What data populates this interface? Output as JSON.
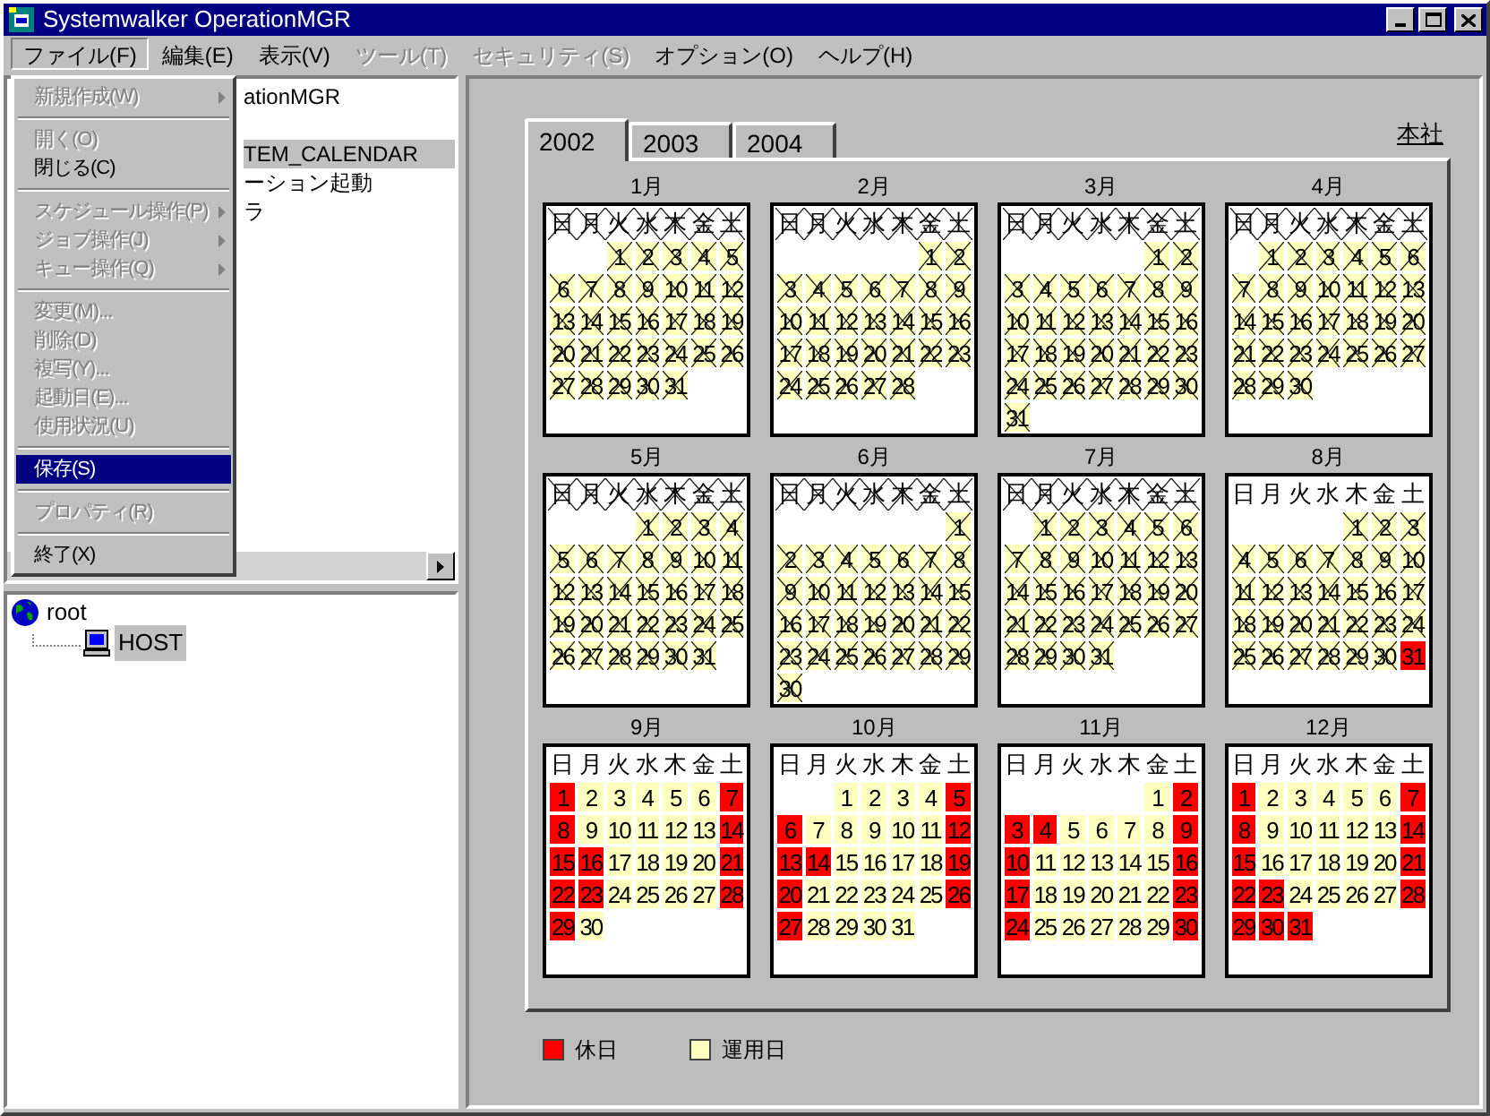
{
  "window": {
    "title": "Systemwalker OperationMGR"
  },
  "menu_bar": [
    {
      "label": "ファイル(F)",
      "selected": true,
      "disabled": false
    },
    {
      "label": "編集(E)",
      "selected": false,
      "disabled": false
    },
    {
      "label": "表示(V)",
      "selected": false,
      "disabled": false
    },
    {
      "label": "ツール(T)",
      "selected": false,
      "disabled": true
    },
    {
      "label": "セキュリティ(S)",
      "selected": false,
      "disabled": true
    },
    {
      "label": "オプション(O)",
      "selected": false,
      "disabled": false
    },
    {
      "label": "ヘルプ(H)",
      "selected": false,
      "disabled": false
    }
  ],
  "file_menu": [
    {
      "kind": "item",
      "label": "新規作成(W)",
      "disabled": true,
      "submenu": true,
      "selected": false
    },
    {
      "kind": "separator"
    },
    {
      "kind": "item",
      "label": "開く(O)",
      "disabled": true,
      "submenu": false,
      "selected": false
    },
    {
      "kind": "item",
      "label": "閉じる(C)",
      "disabled": false,
      "submenu": false,
      "selected": false
    },
    {
      "kind": "separator"
    },
    {
      "kind": "item",
      "label": "スケジュール操作(P)",
      "disabled": true,
      "submenu": true,
      "selected": false
    },
    {
      "kind": "item",
      "label": "ジョブ操作(J)",
      "disabled": true,
      "submenu": true,
      "selected": false
    },
    {
      "kind": "item",
      "label": "キュー操作(Q)",
      "disabled": true,
      "submenu": true,
      "selected": false
    },
    {
      "kind": "separator"
    },
    {
      "kind": "item",
      "label": "変更(M)...",
      "disabled": true,
      "submenu": false,
      "selected": false
    },
    {
      "kind": "item",
      "label": "削除(D)",
      "disabled": true,
      "submenu": false,
      "selected": false
    },
    {
      "kind": "item",
      "label": "複写(Y)...",
      "disabled": true,
      "submenu": false,
      "selected": false
    },
    {
      "kind": "item",
      "label": "起動日(E)...",
      "disabled": true,
      "submenu": false,
      "selected": false
    },
    {
      "kind": "item",
      "label": "使用状況(U)",
      "disabled": true,
      "submenu": false,
      "selected": false
    },
    {
      "kind": "separator"
    },
    {
      "kind": "item",
      "label": "保存(S)",
      "disabled": false,
      "submenu": false,
      "selected": true
    },
    {
      "kind": "separator"
    },
    {
      "kind": "item",
      "label": "プロパティ(R)",
      "disabled": true,
      "submenu": false,
      "selected": false
    },
    {
      "kind": "separator"
    },
    {
      "kind": "item",
      "label": "終了(X)",
      "disabled": false,
      "submenu": false,
      "selected": false
    }
  ],
  "tree_top": [
    {
      "label": "ationMGR",
      "selected": false
    },
    {
      "label": "TEM_CALENDAR",
      "selected": true
    },
    {
      "label": "ーション起動",
      "selected": false
    },
    {
      "label": "ラ",
      "selected": false
    }
  ],
  "tree_bottom": {
    "label": "root",
    "selected": false,
    "children": [
      {
        "label": "HOST",
        "selected": true
      }
    ]
  },
  "tabs": [
    {
      "label": "2002",
      "selected": true
    },
    {
      "label": "2003",
      "selected": false
    },
    {
      "label": "2004",
      "selected": false
    }
  ],
  "location": "本社",
  "months": [
    {
      "title": "1月",
      "weekdays": [
        "日",
        "月",
        "火",
        "水",
        "木",
        "金",
        "土"
      ],
      "header_crossed": true,
      "days": [
        {
          "kind": "blank"
        },
        {
          "kind": "blank"
        },
        {
          "label": "1",
          "kind": "past"
        },
        {
          "label": "2",
          "kind": "past"
        },
        {
          "label": "3",
          "kind": "past"
        },
        {
          "label": "4",
          "kind": "past"
        },
        {
          "label": "5",
          "kind": "past"
        },
        {
          "label": "6",
          "kind": "past"
        },
        {
          "label": "7",
          "kind": "past"
        },
        {
          "label": "8",
          "kind": "past"
        },
        {
          "label": "9",
          "kind": "past"
        },
        {
          "label": "10",
          "kind": "past"
        },
        {
          "label": "11",
          "kind": "past"
        },
        {
          "label": "12",
          "kind": "past"
        },
        {
          "label": "13",
          "kind": "past"
        },
        {
          "label": "14",
          "kind": "past"
        },
        {
          "label": "15",
          "kind": "past"
        },
        {
          "label": "16",
          "kind": "past"
        },
        {
          "label": "17",
          "kind": "past"
        },
        {
          "label": "18",
          "kind": "past"
        },
        {
          "label": "19",
          "kind": "past"
        },
        {
          "label": "20",
          "kind": "past"
        },
        {
          "label": "21",
          "kind": "past"
        },
        {
          "label": "22",
          "kind": "past"
        },
        {
          "label": "23",
          "kind": "past"
        },
        {
          "label": "24",
          "kind": "past"
        },
        {
          "label": "25",
          "kind": "past"
        },
        {
          "label": "26",
          "kind": "past"
        },
        {
          "label": "27",
          "kind": "past"
        },
        {
          "label": "28",
          "kind": "past"
        },
        {
          "label": "29",
          "kind": "past"
        },
        {
          "label": "30",
          "kind": "past"
        },
        {
          "label": "31",
          "kind": "past"
        }
      ]
    },
    {
      "title": "2月",
      "weekdays": [
        "日",
        "月",
        "火",
        "水",
        "木",
        "金",
        "土"
      ],
      "header_crossed": true,
      "days": [
        {
          "kind": "blank"
        },
        {
          "kind": "blank"
        },
        {
          "kind": "blank"
        },
        {
          "kind": "blank"
        },
        {
          "kind": "blank"
        },
        {
          "label": "1",
          "kind": "past"
        },
        {
          "label": "2",
          "kind": "past"
        },
        {
          "label": "3",
          "kind": "past"
        },
        {
          "label": "4",
          "kind": "past"
        },
        {
          "label": "5",
          "kind": "past"
        },
        {
          "label": "6",
          "kind": "past"
        },
        {
          "label": "7",
          "kind": "past"
        },
        {
          "label": "8",
          "kind": "past"
        },
        {
          "label": "9",
          "kind": "past"
        },
        {
          "label": "10",
          "kind": "past"
        },
        {
          "label": "11",
          "kind": "past"
        },
        {
          "label": "12",
          "kind": "past"
        },
        {
          "label": "13",
          "kind": "past"
        },
        {
          "label": "14",
          "kind": "past"
        },
        {
          "label": "15",
          "kind": "past"
        },
        {
          "label": "16",
          "kind": "past"
        },
        {
          "label": "17",
          "kind": "past"
        },
        {
          "label": "18",
          "kind": "past"
        },
        {
          "label": "19",
          "kind": "past"
        },
        {
          "label": "20",
          "kind": "past"
        },
        {
          "label": "21",
          "kind": "past"
        },
        {
          "label": "22",
          "kind": "past"
        },
        {
          "label": "23",
          "kind": "past"
        },
        {
          "label": "24",
          "kind": "past"
        },
        {
          "label": "25",
          "kind": "past"
        },
        {
          "label": "26",
          "kind": "past"
        },
        {
          "label": "27",
          "kind": "past"
        },
        {
          "label": "28",
          "kind": "past"
        }
      ]
    },
    {
      "title": "3月",
      "weekdays": [
        "日",
        "月",
        "火",
        "水",
        "木",
        "金",
        "土"
      ],
      "header_crossed": true,
      "days": [
        {
          "kind": "blank"
        },
        {
          "kind": "blank"
        },
        {
          "kind": "blank"
        },
        {
          "kind": "blank"
        },
        {
          "kind": "blank"
        },
        {
          "label": "1",
          "kind": "past"
        },
        {
          "label": "2",
          "kind": "past"
        },
        {
          "label": "3",
          "kind": "past"
        },
        {
          "label": "4",
          "kind": "past"
        },
        {
          "label": "5",
          "kind": "past"
        },
        {
          "label": "6",
          "kind": "past"
        },
        {
          "label": "7",
          "kind": "past"
        },
        {
          "label": "8",
          "kind": "past"
        },
        {
          "label": "9",
          "kind": "past"
        },
        {
          "label": "10",
          "kind": "past"
        },
        {
          "label": "11",
          "kind": "past"
        },
        {
          "label": "12",
          "kind": "past"
        },
        {
          "label": "13",
          "kind": "past"
        },
        {
          "label": "14",
          "kind": "past"
        },
        {
          "label": "15",
          "kind": "past"
        },
        {
          "label": "16",
          "kind": "past"
        },
        {
          "label": "17",
          "kind": "past"
        },
        {
          "label": "18",
          "kind": "past"
        },
        {
          "label": "19",
          "kind": "past"
        },
        {
          "label": "20",
          "kind": "past"
        },
        {
          "label": "21",
          "kind": "past"
        },
        {
          "label": "22",
          "kind": "past"
        },
        {
          "label": "23",
          "kind": "past"
        },
        {
          "label": "24",
          "kind": "past"
        },
        {
          "label": "25",
          "kind": "past"
        },
        {
          "label": "26",
          "kind": "past"
        },
        {
          "label": "27",
          "kind": "past"
        },
        {
          "label": "28",
          "kind": "past"
        },
        {
          "label": "29",
          "kind": "past"
        },
        {
          "label": "30",
          "kind": "past"
        },
        {
          "label": "31",
          "kind": "past"
        }
      ]
    },
    {
      "title": "4月",
      "weekdays": [
        "日",
        "月",
        "火",
        "水",
        "木",
        "金",
        "土"
      ],
      "header_crossed": true,
      "days": [
        {
          "kind": "blank"
        },
        {
          "label": "1",
          "kind": "past"
        },
        {
          "label": "2",
          "kind": "past"
        },
        {
          "label": "3",
          "kind": "past"
        },
        {
          "label": "4",
          "kind": "past"
        },
        {
          "label": "5",
          "kind": "past"
        },
        {
          "label": "6",
          "kind": "past"
        },
        {
          "label": "7",
          "kind": "past"
        },
        {
          "label": "8",
          "kind": "past"
        },
        {
          "label": "9",
          "kind": "past"
        },
        {
          "label": "10",
          "kind": "past"
        },
        {
          "label": "11",
          "kind": "past"
        },
        {
          "label": "12",
          "kind": "past"
        },
        {
          "label": "13",
          "kind": "past"
        },
        {
          "label": "14",
          "kind": "past"
        },
        {
          "label": "15",
          "kind": "past"
        },
        {
          "label": "16",
          "kind": "past"
        },
        {
          "label": "17",
          "kind": "past"
        },
        {
          "label": "18",
          "kind": "past"
        },
        {
          "label": "19",
          "kind": "past"
        },
        {
          "label": "20",
          "kind": "past"
        },
        {
          "label": "21",
          "kind": "past"
        },
        {
          "label": "22",
          "kind": "past"
        },
        {
          "label": "23",
          "kind": "past"
        },
        {
          "label": "24",
          "kind": "past"
        },
        {
          "label": "25",
          "kind": "past"
        },
        {
          "label": "26",
          "kind": "past"
        },
        {
          "label": "27",
          "kind": "past"
        },
        {
          "label": "28",
          "kind": "past"
        },
        {
          "label": "29",
          "kind": "past"
        },
        {
          "label": "30",
          "kind": "past"
        }
      ]
    },
    {
      "title": "5月",
      "weekdays": [
        "日",
        "月",
        "火",
        "水",
        "木",
        "金",
        "土"
      ],
      "header_crossed": true,
      "days": [
        {
          "kind": "blank"
        },
        {
          "kind": "blank"
        },
        {
          "kind": "blank"
        },
        {
          "label": "1",
          "kind": "past"
        },
        {
          "label": "2",
          "kind": "past"
        },
        {
          "label": "3",
          "kind": "past"
        },
        {
          "label": "4",
          "kind": "past"
        },
        {
          "label": "5",
          "kind": "past"
        },
        {
          "label": "6",
          "kind": "past"
        },
        {
          "label": "7",
          "kind": "past"
        },
        {
          "label": "8",
          "kind": "past"
        },
        {
          "label": "9",
          "kind": "past"
        },
        {
          "label": "10",
          "kind": "past"
        },
        {
          "label": "11",
          "kind": "past"
        },
        {
          "label": "12",
          "kind": "past"
        },
        {
          "label": "13",
          "kind": "past"
        },
        {
          "label": "14",
          "kind": "past"
        },
        {
          "label": "15",
          "kind": "past"
        },
        {
          "label": "16",
          "kind": "past"
        },
        {
          "label": "17",
          "kind": "past"
        },
        {
          "label": "18",
          "kind": "past"
        },
        {
          "label": "19",
          "kind": "past"
        },
        {
          "label": "20",
          "kind": "past"
        },
        {
          "label": "21",
          "kind": "past"
        },
        {
          "label": "22",
          "kind": "past"
        },
        {
          "label": "23",
          "kind": "past"
        },
        {
          "label": "24",
          "kind": "past"
        },
        {
          "label": "25",
          "kind": "past"
        },
        {
          "label": "26",
          "kind": "past"
        },
        {
          "label": "27",
          "kind": "past"
        },
        {
          "label": "28",
          "kind": "past"
        },
        {
          "label": "29",
          "kind": "past"
        },
        {
          "label": "30",
          "kind": "past"
        },
        {
          "label": "31",
          "kind": "past"
        }
      ]
    },
    {
      "title": "6月",
      "weekdays": [
        "日",
        "月",
        "火",
        "水",
        "木",
        "金",
        "土"
      ],
      "header_crossed": true,
      "days": [
        {
          "kind": "blank"
        },
        {
          "kind": "blank"
        },
        {
          "kind": "blank"
        },
        {
          "kind": "blank"
        },
        {
          "kind": "blank"
        },
        {
          "kind": "blank"
        },
        {
          "label": "1",
          "kind": "past"
        },
        {
          "label": "2",
          "kind": "past"
        },
        {
          "label": "3",
          "kind": "past"
        },
        {
          "label": "4",
          "kind": "past"
        },
        {
          "label": "5",
          "kind": "past"
        },
        {
          "label": "6",
          "kind": "past"
        },
        {
          "label": "7",
          "kind": "past"
        },
        {
          "label": "8",
          "kind": "past"
        },
        {
          "label": "9",
          "kind": "past"
        },
        {
          "label": "10",
          "kind": "past"
        },
        {
          "label": "11",
          "kind": "past"
        },
        {
          "label": "12",
          "kind": "past"
        },
        {
          "label": "13",
          "kind": "past"
        },
        {
          "label": "14",
          "kind": "past"
        },
        {
          "label": "15",
          "kind": "past"
        },
        {
          "label": "16",
          "kind": "past"
        },
        {
          "label": "17",
          "kind": "past"
        },
        {
          "label": "18",
          "kind": "past"
        },
        {
          "label": "19",
          "kind": "past"
        },
        {
          "label": "20",
          "kind": "past"
        },
        {
          "label": "21",
          "kind": "past"
        },
        {
          "label": "22",
          "kind": "past"
        },
        {
          "label": "23",
          "kind": "past"
        },
        {
          "label": "24",
          "kind": "past"
        },
        {
          "label": "25",
          "kind": "past"
        },
        {
          "label": "26",
          "kind": "past"
        },
        {
          "label": "27",
          "kind": "past"
        },
        {
          "label": "28",
          "kind": "past"
        },
        {
          "label": "29",
          "kind": "past"
        },
        {
          "label": "30",
          "kind": "past"
        }
      ]
    },
    {
      "title": "7月",
      "weekdays": [
        "日",
        "月",
        "火",
        "水",
        "木",
        "金",
        "土"
      ],
      "header_crossed": true,
      "days": [
        {
          "kind": "blank"
        },
        {
          "label": "1",
          "kind": "past"
        },
        {
          "label": "2",
          "kind": "past"
        },
        {
          "label": "3",
          "kind": "past"
        },
        {
          "label": "4",
          "kind": "past"
        },
        {
          "label": "5",
          "kind": "past"
        },
        {
          "label": "6",
          "kind": "past"
        },
        {
          "label": "7",
          "kind": "past"
        },
        {
          "label": "8",
          "kind": "past"
        },
        {
          "label": "9",
          "kind": "past"
        },
        {
          "label": "10",
          "kind": "past"
        },
        {
          "label": "11",
          "kind": "past"
        },
        {
          "label": "12",
          "kind": "past"
        },
        {
          "label": "13",
          "kind": "past"
        },
        {
          "label": "14",
          "kind": "past"
        },
        {
          "label": "15",
          "kind": "past"
        },
        {
          "label": "16",
          "kind": "past"
        },
        {
          "label": "17",
          "kind": "past"
        },
        {
          "label": "18",
          "kind": "past"
        },
        {
          "label": "19",
          "kind": "past"
        },
        {
          "label": "20",
          "kind": "past"
        },
        {
          "label": "21",
          "kind": "past"
        },
        {
          "label": "22",
          "kind": "past"
        },
        {
          "label": "23",
          "kind": "past"
        },
        {
          "label": "24",
          "kind": "past"
        },
        {
          "label": "25",
          "kind": "past"
        },
        {
          "label": "26",
          "kind": "past"
        },
        {
          "label": "27",
          "kind": "past"
        },
        {
          "label": "28",
          "kind": "past"
        },
        {
          "label": "29",
          "kind": "past"
        },
        {
          "label": "30",
          "kind": "past"
        },
        {
          "label": "31",
          "kind": "past"
        }
      ]
    },
    {
      "title": "8月",
      "weekdays": [
        "日",
        "月",
        "火",
        "水",
        "木",
        "金",
        "土"
      ],
      "header_crossed": false,
      "days": [
        {
          "kind": "blank"
        },
        {
          "kind": "blank"
        },
        {
          "kind": "blank"
        },
        {
          "kind": "blank"
        },
        {
          "label": "1",
          "kind": "past"
        },
        {
          "label": "2",
          "kind": "past"
        },
        {
          "label": "3",
          "kind": "past"
        },
        {
          "label": "4",
          "kind": "past"
        },
        {
          "label": "5",
          "kind": "past"
        },
        {
          "label": "6",
          "kind": "past"
        },
        {
          "label": "7",
          "kind": "past"
        },
        {
          "label": "8",
          "kind": "past"
        },
        {
          "label": "9",
          "kind": "past"
        },
        {
          "label": "10",
          "kind": "past"
        },
        {
          "label": "11",
          "kind": "past"
        },
        {
          "label": "12",
          "kind": "past"
        },
        {
          "label": "13",
          "kind": "past"
        },
        {
          "label": "14",
          "kind": "past"
        },
        {
          "label": "15",
          "kind": "past"
        },
        {
          "label": "16",
          "kind": "past"
        },
        {
          "label": "17",
          "kind": "past"
        },
        {
          "label": "18",
          "kind": "past"
        },
        {
          "label": "19",
          "kind": "past"
        },
        {
          "label": "20",
          "kind": "past"
        },
        {
          "label": "21",
          "kind": "past"
        },
        {
          "label": "22",
          "kind": "past"
        },
        {
          "label": "23",
          "kind": "past"
        },
        {
          "label": "24",
          "kind": "past"
        },
        {
          "label": "25",
          "kind": "past"
        },
        {
          "label": "26",
          "kind": "past"
        },
        {
          "label": "27",
          "kind": "past"
        },
        {
          "label": "28",
          "kind": "past"
        },
        {
          "label": "29",
          "kind": "past"
        },
        {
          "label": "30",
          "kind": "past"
        },
        {
          "label": "31",
          "kind": "holiday"
        }
      ]
    },
    {
      "title": "9月",
      "weekdays": [
        "日",
        "月",
        "火",
        "水",
        "木",
        "金",
        "土"
      ],
      "header_crossed": false,
      "days": [
        {
          "label": "1",
          "kind": "holiday"
        },
        {
          "label": "2",
          "kind": "work"
        },
        {
          "label": "3",
          "kind": "work"
        },
        {
          "label": "4",
          "kind": "work"
        },
        {
          "label": "5",
          "kind": "work"
        },
        {
          "label": "6",
          "kind": "work"
        },
        {
          "label": "7",
          "kind": "holiday"
        },
        {
          "label": "8",
          "kind": "holiday"
        },
        {
          "label": "9",
          "kind": "work"
        },
        {
          "label": "10",
          "kind": "work"
        },
        {
          "label": "11",
          "kind": "work"
        },
        {
          "label": "12",
          "kind": "work"
        },
        {
          "label": "13",
          "kind": "work"
        },
        {
          "label": "14",
          "kind": "holiday"
        },
        {
          "label": "15",
          "kind": "holiday"
        },
        {
          "label": "16",
          "kind": "holiday"
        },
        {
          "label": "17",
          "kind": "work"
        },
        {
          "label": "18",
          "kind": "work"
        },
        {
          "label": "19",
          "kind": "work"
        },
        {
          "label": "20",
          "kind": "work"
        },
        {
          "label": "21",
          "kind": "holiday"
        },
        {
          "label": "22",
          "kind": "holiday"
        },
        {
          "label": "23",
          "kind": "holiday"
        },
        {
          "label": "24",
          "kind": "work"
        },
        {
          "label": "25",
          "kind": "work"
        },
        {
          "label": "26",
          "kind": "work"
        },
        {
          "label": "27",
          "kind": "work"
        },
        {
          "label": "28",
          "kind": "holiday"
        },
        {
          "label": "29",
          "kind": "holiday"
        },
        {
          "label": "30",
          "kind": "work"
        }
      ]
    },
    {
      "title": "10月",
      "weekdays": [
        "日",
        "月",
        "火",
        "水",
        "木",
        "金",
        "土"
      ],
      "header_crossed": false,
      "days": [
        {
          "kind": "blank"
        },
        {
          "kind": "blank"
        },
        {
          "label": "1",
          "kind": "work"
        },
        {
          "label": "2",
          "kind": "work"
        },
        {
          "label": "3",
          "kind": "work"
        },
        {
          "label": "4",
          "kind": "work"
        },
        {
          "label": "5",
          "kind": "holiday"
        },
        {
          "label": "6",
          "kind": "holiday"
        },
        {
          "label": "7",
          "kind": "work"
        },
        {
          "label": "8",
          "kind": "work"
        },
        {
          "label": "9",
          "kind": "work"
        },
        {
          "label": "10",
          "kind": "work"
        },
        {
          "label": "11",
          "kind": "work"
        },
        {
          "label": "12",
          "kind": "holiday"
        },
        {
          "label": "13",
          "kind": "holiday"
        },
        {
          "label": "14",
          "kind": "holiday"
        },
        {
          "label": "15",
          "kind": "work"
        },
        {
          "label": "16",
          "kind": "work"
        },
        {
          "label": "17",
          "kind": "work"
        },
        {
          "label": "18",
          "kind": "work"
        },
        {
          "label": "19",
          "kind": "holiday"
        },
        {
          "label": "20",
          "kind": "holiday"
        },
        {
          "label": "21",
          "kind": "work"
        },
        {
          "label": "22",
          "kind": "work"
        },
        {
          "label": "23",
          "kind": "work"
        },
        {
          "label": "24",
          "kind": "work"
        },
        {
          "label": "25",
          "kind": "work"
        },
        {
          "label": "26",
          "kind": "holiday"
        },
        {
          "label": "27",
          "kind": "holiday"
        },
        {
          "label": "28",
          "kind": "work"
        },
        {
          "label": "29",
          "kind": "work"
        },
        {
          "label": "30",
          "kind": "work"
        },
        {
          "label": "31",
          "kind": "work"
        }
      ]
    },
    {
      "title": "11月",
      "weekdays": [
        "日",
        "月",
        "火",
        "水",
        "木",
        "金",
        "土"
      ],
      "header_crossed": false,
      "days": [
        {
          "kind": "blank"
        },
        {
          "kind": "blank"
        },
        {
          "kind": "blank"
        },
        {
          "kind": "blank"
        },
        {
          "kind": "blank"
        },
        {
          "label": "1",
          "kind": "work"
        },
        {
          "label": "2",
          "kind": "holiday"
        },
        {
          "label": "3",
          "kind": "holiday"
        },
        {
          "label": "4",
          "kind": "holiday"
        },
        {
          "label": "5",
          "kind": "work"
        },
        {
          "label": "6",
          "kind": "work"
        },
        {
          "label": "7",
          "kind": "work"
        },
        {
          "label": "8",
          "kind": "work"
        },
        {
          "label": "9",
          "kind": "holiday"
        },
        {
          "label": "10",
          "kind": "holiday"
        },
        {
          "label": "11",
          "kind": "work"
        },
        {
          "label": "12",
          "kind": "work"
        },
        {
          "label": "13",
          "kind": "work"
        },
        {
          "label": "14",
          "kind": "work"
        },
        {
          "label": "15",
          "kind": "work"
        },
        {
          "label": "16",
          "kind": "holiday"
        },
        {
          "label": "17",
          "kind": "holiday"
        },
        {
          "label": "18",
          "kind": "work"
        },
        {
          "label": "19",
          "kind": "work"
        },
        {
          "label": "20",
          "kind": "work"
        },
        {
          "label": "21",
          "kind": "work"
        },
        {
          "label": "22",
          "kind": "work"
        },
        {
          "label": "23",
          "kind": "holiday"
        },
        {
          "label": "24",
          "kind": "holiday"
        },
        {
          "label": "25",
          "kind": "work"
        },
        {
          "label": "26",
          "kind": "work"
        },
        {
          "label": "27",
          "kind": "work"
        },
        {
          "label": "28",
          "kind": "work"
        },
        {
          "label": "29",
          "kind": "work"
        },
        {
          "label": "30",
          "kind": "holiday"
        }
      ]
    },
    {
      "title": "12月",
      "weekdays": [
        "日",
        "月",
        "火",
        "水",
        "木",
        "金",
        "土"
      ],
      "header_crossed": false,
      "days": [
        {
          "label": "1",
          "kind": "holiday"
        },
        {
          "label": "2",
          "kind": "work"
        },
        {
          "label": "3",
          "kind": "work"
        },
        {
          "label": "4",
          "kind": "work"
        },
        {
          "label": "5",
          "kind": "work"
        },
        {
          "label": "6",
          "kind": "work"
        },
        {
          "label": "7",
          "kind": "holiday"
        },
        {
          "label": "8",
          "kind": "holiday"
        },
        {
          "label": "9",
          "kind": "work"
        },
        {
          "label": "10",
          "kind": "work"
        },
        {
          "label": "11",
          "kind": "work"
        },
        {
          "label": "12",
          "kind": "work"
        },
        {
          "label": "13",
          "kind": "work"
        },
        {
          "label": "14",
          "kind": "holiday"
        },
        {
          "label": "15",
          "kind": "holiday"
        },
        {
          "label": "16",
          "kind": "work"
        },
        {
          "label": "17",
          "kind": "work"
        },
        {
          "label": "18",
          "kind": "work"
        },
        {
          "label": "19",
          "kind": "work"
        },
        {
          "label": "20",
          "kind": "work"
        },
        {
          "label": "21",
          "kind": "holiday"
        },
        {
          "label": "22",
          "kind": "holiday"
        },
        {
          "label": "23",
          "kind": "holiday"
        },
        {
          "label": "24",
          "kind": "work"
        },
        {
          "label": "25",
          "kind": "work"
        },
        {
          "label": "26",
          "kind": "work"
        },
        {
          "label": "27",
          "kind": "work"
        },
        {
          "label": "28",
          "kind": "holiday"
        },
        {
          "label": "29",
          "kind": "holiday"
        },
        {
          "label": "30",
          "kind": "holiday"
        },
        {
          "label": "31",
          "kind": "holiday"
        }
      ]
    }
  ],
  "legend": [
    {
      "label": "休日",
      "color": "#ff0000"
    },
    {
      "label": "運用日",
      "color": "#ffffc0"
    }
  ]
}
